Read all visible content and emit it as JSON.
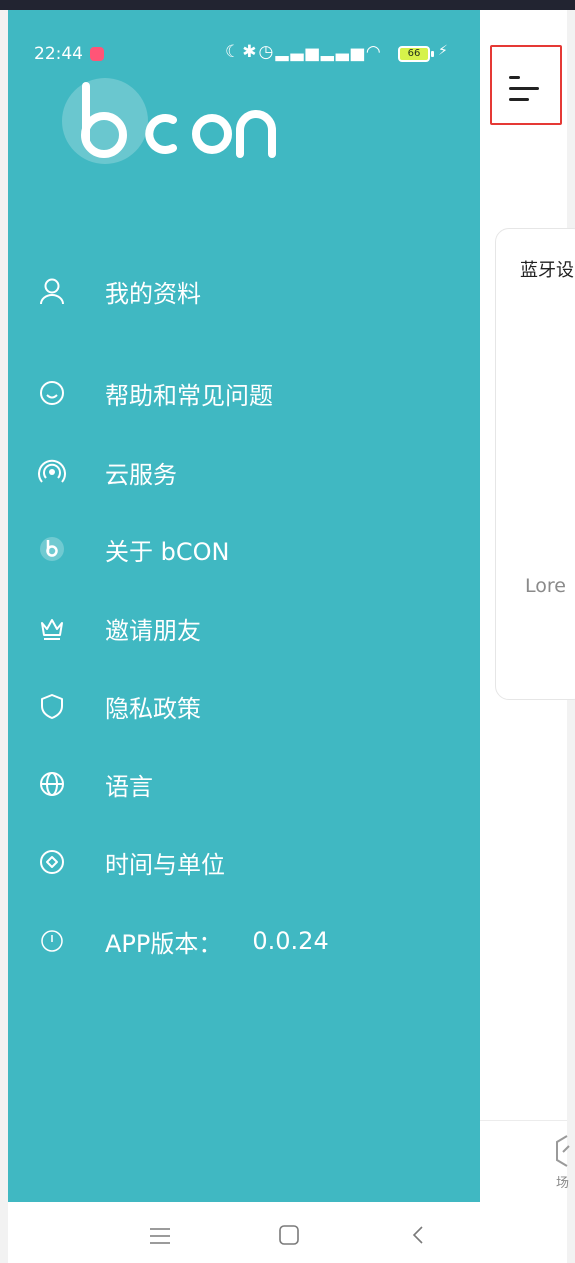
{
  "status_bar": {
    "time": "22:44",
    "icons": [
      "moon-icon",
      "bluetooth-icon",
      "alarm-icon",
      "signal-icon",
      "signal-icon",
      "wifi-icon"
    ],
    "battery": "66"
  },
  "logo": {
    "text": "bcon"
  },
  "drawer": {
    "items": [
      {
        "label": "我的资料",
        "icon": "user-icon"
      },
      {
        "label": "帮助和常见问题",
        "icon": "smile-icon"
      },
      {
        "label": "云服务",
        "icon": "cloud-signal-icon"
      },
      {
        "label": "关于 bCON",
        "icon": "bcon-logo-icon"
      },
      {
        "label": "邀请朋友",
        "icon": "crown-icon"
      },
      {
        "label": "隐私政策",
        "icon": "shield-icon"
      },
      {
        "label": "语言",
        "icon": "globe-icon"
      },
      {
        "label": "时间与单位",
        "icon": "time-unit-icon"
      }
    ],
    "version": {
      "label": "APP版本：",
      "value": "0.0.24",
      "icon": "info-icon"
    }
  },
  "main": {
    "card_title": "蓝牙设",
    "card_text": "Lore",
    "bottom_tab_label": "场"
  },
  "nav_bar": {
    "icons": [
      "menu-lines-icon",
      "home-square-icon",
      "back-chevron-icon"
    ]
  },
  "colors": {
    "drawer": "#40b8c2",
    "highlight": "#e53935",
    "battery": "#d6f24a"
  }
}
